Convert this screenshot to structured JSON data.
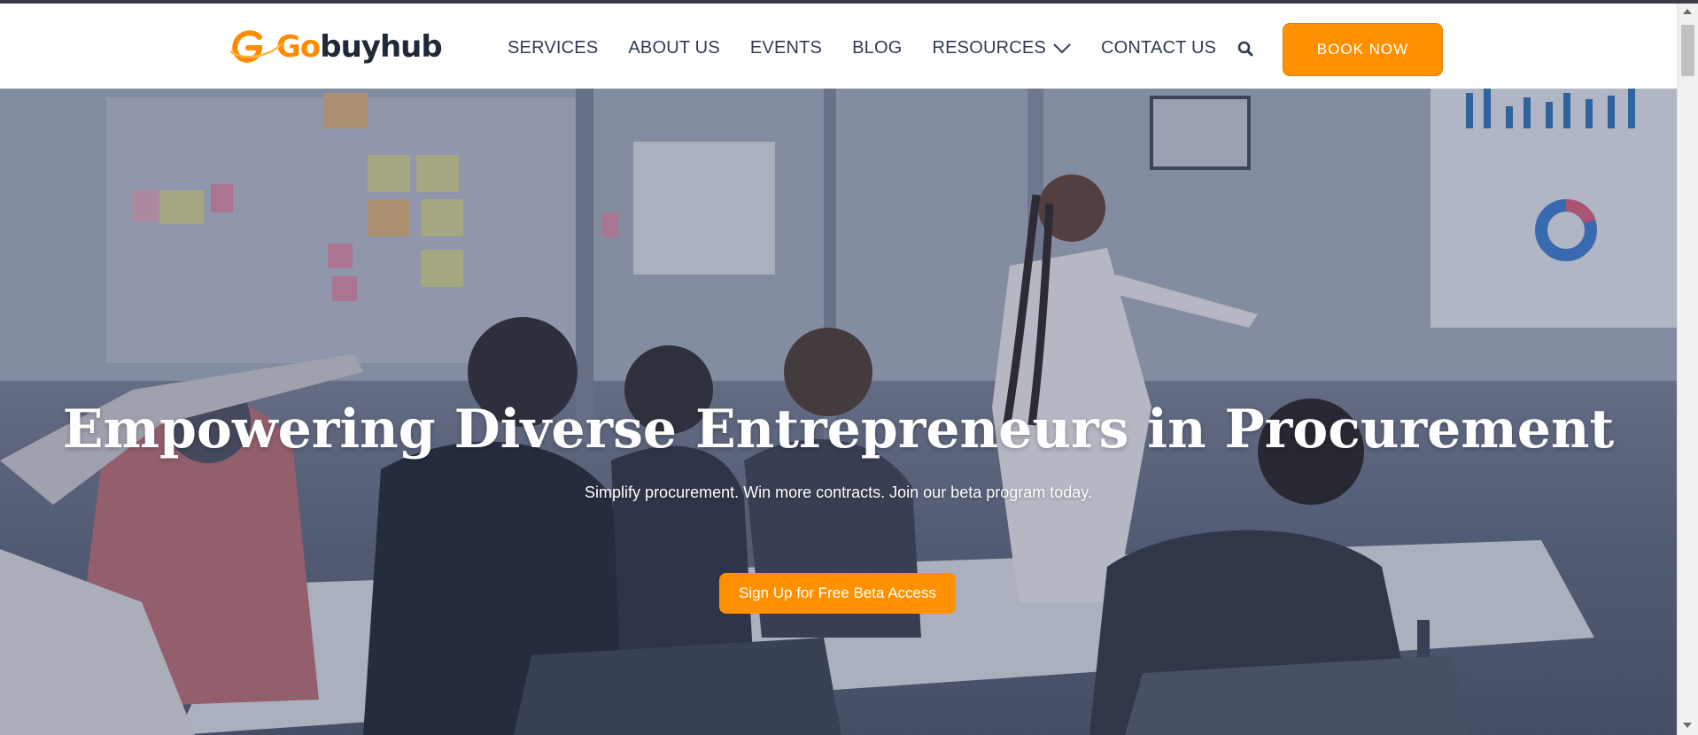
{
  "brand": {
    "logo_go": "Go",
    "logo_rest": "buyhub",
    "accent": "#ff9100",
    "text_dark": "#2f3b52"
  },
  "nav": {
    "items": [
      {
        "label": "SERVICES",
        "has_dropdown": false
      },
      {
        "label": "ABOUT US",
        "has_dropdown": false
      },
      {
        "label": "EVENTS",
        "has_dropdown": false
      },
      {
        "label": "BLOG",
        "has_dropdown": false
      },
      {
        "label": "RESOURCES",
        "has_dropdown": true
      },
      {
        "label": "CONTACT US",
        "has_dropdown": false
      }
    ],
    "search_icon": "search-icon",
    "book_label": "BOOK NOW"
  },
  "hero": {
    "title": "Empowering Diverse Entrepreneurs in Procurement",
    "subtitle": "Simplify procurement. Win more contracts. Join our beta program today.",
    "cta_label": "Sign Up for Free Beta Access",
    "image": "team meeting in office with presenter at screen"
  }
}
